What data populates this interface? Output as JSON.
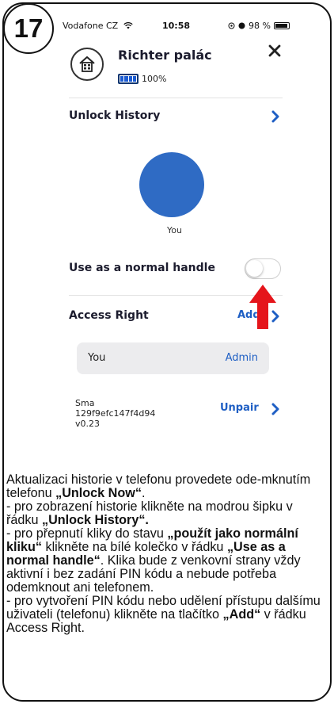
{
  "step_number": "17",
  "status_bar": {
    "carrier": "Vodafone CZ",
    "time": "10:58",
    "battery": "98 %"
  },
  "device": {
    "name": "Richter palác",
    "battery_level": "100%"
  },
  "unlock_history": {
    "title": "Unlock History",
    "user_label": "You"
  },
  "normal_handle": {
    "label": "Use as a normal handle",
    "enabled": false
  },
  "access_right": {
    "title": "Access Right",
    "add_label": "Add",
    "entries": [
      {
        "user": "You",
        "role": "Admin"
      }
    ]
  },
  "lock": {
    "model": "Sma",
    "id": "129f9efc147f4d94",
    "version": "v0.23",
    "unpair_label": "Unpair"
  },
  "colors": {
    "accent": "#1f5fc4",
    "avatar": "#2f6bc4",
    "arrow": "#e5151b"
  },
  "icons": [
    "wifi-icon",
    "home-icon",
    "close-icon",
    "chevron-right-icon",
    "red-arrow-up-icon"
  ],
  "instructions": {
    "p1_a": "Aktualizaci historie v telefonu provedete ode-mknutím telefonu ",
    "p1_b": "„Unlock Now“",
    "p1_c": ".",
    "p2_a": "-      pro zobrazení historie klikněte na modrou šipku v řádku ",
    "p2_b": "„Unlock History“.",
    "p3_a": "-      pro přepnutí kliky do stavu ",
    "p3_b": "„použít jako normální kliku“",
    "p3_c": " klikněte na bílé kolečko v řádku ",
    "p3_d": "„Use as a normal handle“",
    "p3_e": ". Klika bude z venkovní strany vždy aktivní i bez zadání PIN kódu a nebude potřeba odemknout ani telefonem.",
    "p4_a": "-      pro vytvoření PIN kódu nebo udělení přístupu dalšímu uživateli (telefonu) klikněte na tlačítko ",
    "p4_b": "„Add“",
    "p4_c": " v řádku Access Right."
  }
}
